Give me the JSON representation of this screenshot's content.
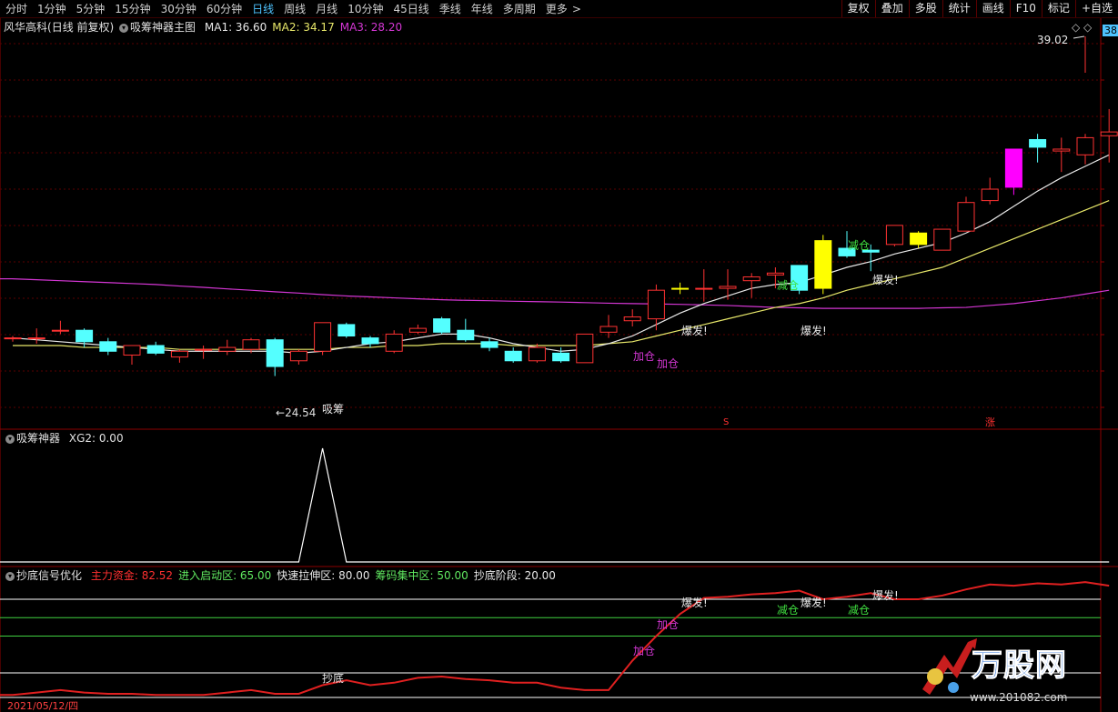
{
  "toolbar": {
    "periods": [
      "分时",
      "1分钟",
      "5分钟",
      "15分钟",
      "30分钟",
      "60分钟",
      "日线",
      "周线",
      "月线",
      "10分钟",
      "45日线",
      "季线",
      "年线",
      "多周期",
      "更多"
    ],
    "active_period": "日线",
    "more_arrow": ">",
    "tools": [
      "复权",
      "叠加",
      "多股",
      "统计",
      "画线",
      "F10",
      "标记",
      "+自选"
    ]
  },
  "main_panel": {
    "stock_name": "风华高科",
    "adjust_mode": "(日线 前复权)",
    "indicator_name": "吸筹神器主图",
    "ma": [
      {
        "label": "MA1: 36.60",
        "color": "#e8e8e8"
      },
      {
        "label": "MA2: 34.17",
        "color": "#e8e86a"
      },
      {
        "label": "MA3: 28.20",
        "color": "#d436d4"
      }
    ],
    "price_high_label": "39.02",
    "price_low_label": "24.54",
    "right_price_tag": "38",
    "marker_s": "S",
    "marker_zhang": "涨",
    "signals": {
      "buy_zone": "吸筹",
      "add": "加仓",
      "burst": "爆发!",
      "reduce": "减仓"
    }
  },
  "xg_panel": {
    "title": "吸筹神器",
    "value": "XG2: 0.00",
    "peak_value": 1,
    "peak_index": 13
  },
  "bottom_panel": {
    "title": "抄底信号优化",
    "fields": [
      {
        "label": "主力资金: 82.52",
        "color": "#ff3030"
      },
      {
        "label": "进入启动区: 65.00",
        "color": "#60e860"
      },
      {
        "label": "快速拉伸区: 80.00",
        "color": "#e8e8e8"
      },
      {
        "label": "筹码集中区: 50.00",
        "color": "#60e860"
      },
      {
        "label": "抄底阶段: 20.00",
        "color": "#e8e8e8"
      }
    ],
    "date_label": "2021/05/12/四",
    "signals": {
      "bottom": "抄底",
      "add": "加仓",
      "burst": "爆发!",
      "reduce": "减仓"
    }
  },
  "watermark": {
    "brand": "万股网",
    "url": "www.201082.com"
  },
  "colors": {
    "up": "#ff3232",
    "down": "#54ffff",
    "special_up_yellow": "#ffff00",
    "special_up_magenta": "#ff00ff",
    "ma1": "#e8e8e8",
    "ma2": "#e8e86a",
    "ma3": "#d436d4",
    "grid": "#8b0000"
  },
  "chart_data": {
    "type": "candlestick",
    "price_range": [
      23.5,
      41
    ],
    "candles": [
      {
        "o": 27.0,
        "h": 27.1,
        "l": 26.8,
        "c": 27.0
      },
      {
        "o": 27.0,
        "h": 27.5,
        "l": 26.7,
        "c": 27.0
      },
      {
        "o": 27.4,
        "h": 27.9,
        "l": 27.2,
        "c": 27.4
      },
      {
        "o": 27.4,
        "h": 27.5,
        "l": 26.5,
        "c": 26.8
      },
      {
        "o": 26.8,
        "h": 27.0,
        "l": 26.1,
        "c": 26.3
      },
      {
        "o": 26.1,
        "h": 26.6,
        "l": 25.6,
        "c": 26.6
      },
      {
        "o": 26.6,
        "h": 26.8,
        "l": 26.1,
        "c": 26.2
      },
      {
        "o": 26.0,
        "h": 26.4,
        "l": 25.7,
        "c": 26.3
      },
      {
        "o": 26.4,
        "h": 26.6,
        "l": 25.9,
        "c": 26.4
      },
      {
        "o": 26.3,
        "h": 26.9,
        "l": 26.1,
        "c": 26.5
      },
      {
        "o": 26.4,
        "h": 27.0,
        "l": 26.2,
        "c": 26.9
      },
      {
        "o": 26.9,
        "h": 27.0,
        "l": 25.0,
        "c": 25.5
      },
      {
        "o": 25.8,
        "h": 26.4,
        "l": 25.6,
        "c": 26.3
      },
      {
        "o": 26.3,
        "h": 27.8,
        "l": 26.1,
        "c": 27.8
      },
      {
        "o": 27.7,
        "h": 27.8,
        "l": 27.0,
        "c": 27.1
      },
      {
        "o": 27.0,
        "h": 27.1,
        "l": 26.5,
        "c": 26.7
      },
      {
        "o": 26.3,
        "h": 27.4,
        "l": 26.2,
        "c": 27.2
      },
      {
        "o": 27.3,
        "h": 27.7,
        "l": 27.2,
        "c": 27.5
      },
      {
        "o": 28.0,
        "h": 28.1,
        "l": 27.2,
        "c": 27.3
      },
      {
        "o": 27.4,
        "h": 28.0,
        "l": 26.8,
        "c": 26.9
      },
      {
        "o": 26.8,
        "h": 27.0,
        "l": 26.3,
        "c": 26.5
      },
      {
        "o": 26.3,
        "h": 26.5,
        "l": 25.7,
        "c": 25.8
      },
      {
        "o": 25.8,
        "h": 26.7,
        "l": 25.7,
        "c": 26.5
      },
      {
        "o": 26.2,
        "h": 26.5,
        "l": 25.7,
        "c": 25.8
      },
      {
        "o": 25.7,
        "h": 27.2,
        "l": 25.7,
        "c": 27.2
      },
      {
        "o": 27.3,
        "h": 28.2,
        "l": 27.0,
        "c": 27.6
      },
      {
        "o": 27.9,
        "h": 28.5,
        "l": 27.6,
        "c": 28.1
      },
      {
        "o": 28.0,
        "h": 29.8,
        "l": 27.4,
        "c": 29.5
      },
      {
        "o": 29.6,
        "h": 29.9,
        "l": 29.3,
        "c": 29.6
      },
      {
        "o": 29.6,
        "h": 30.6,
        "l": 28.9,
        "c": 29.6
      },
      {
        "o": 29.6,
        "h": 30.6,
        "l": 29.0,
        "c": 29.7
      },
      {
        "o": 30.0,
        "h": 30.4,
        "l": 29.1,
        "c": 30.2
      },
      {
        "o": 30.3,
        "h": 30.7,
        "l": 29.6,
        "c": 30.4
      },
      {
        "o": 30.8,
        "h": 30.8,
        "l": 29.3,
        "c": 29.5
      },
      {
        "o": 29.6,
        "h": 32.4,
        "l": 29.3,
        "c": 32.1
      },
      {
        "o": 31.7,
        "h": 32.6,
        "l": 31.2,
        "c": 31.3
      },
      {
        "o": 31.6,
        "h": 31.9,
        "l": 30.5,
        "c": 31.5
      },
      {
        "o": 31.9,
        "h": 32.9,
        "l": 31.8,
        "c": 32.9
      },
      {
        "o": 32.5,
        "h": 32.6,
        "l": 31.7,
        "c": 31.9
      },
      {
        "o": 31.6,
        "h": 32.7,
        "l": 31.6,
        "c": 32.7
      },
      {
        "o": 32.6,
        "h": 34.4,
        "l": 32.6,
        "c": 34.1
      },
      {
        "o": 34.2,
        "h": 35.4,
        "l": 34.0,
        "c": 34.8
      },
      {
        "o": 34.9,
        "h": 36.3,
        "l": 34.5,
        "c": 36.9
      },
      {
        "o": 37.4,
        "h": 37.7,
        "l": 36.2,
        "c": 37.0
      },
      {
        "o": 36.8,
        "h": 37.5,
        "l": 35.7,
        "c": 36.9
      },
      {
        "o": 36.6,
        "h": 37.7,
        "l": 36.1,
        "c": 37.5
      },
      {
        "o": 37.6,
        "h": 39.0,
        "l": 36.2,
        "c": 37.8
      }
    ],
    "ma1": [
      27.0,
      26.9,
      26.8,
      26.7,
      26.6,
      26.5,
      26.4,
      26.3,
      26.3,
      26.3,
      26.3,
      26.3,
      26.2,
      26.3,
      26.5,
      26.7,
      26.8,
      27.0,
      27.2,
      27.2,
      27.0,
      26.7,
      26.5,
      26.3,
      26.4,
      26.7,
      27.1,
      27.7,
      28.3,
      28.8,
      29.2,
      29.6,
      29.8,
      29.9,
      30.3,
      30.7,
      31.0,
      31.4,
      31.7,
      32.0,
      32.5,
      33.1,
      33.9,
      34.7,
      35.4,
      36.0,
      36.6
    ],
    "ma2": [
      26.6,
      26.6,
      26.6,
      26.5,
      26.5,
      26.5,
      26.5,
      26.4,
      26.4,
      26.4,
      26.4,
      26.4,
      26.4,
      26.4,
      26.5,
      26.5,
      26.6,
      26.6,
      26.7,
      26.7,
      26.7,
      26.6,
      26.6,
      26.6,
      26.6,
      26.7,
      26.8,
      27.1,
      27.4,
      27.7,
      28.0,
      28.3,
      28.6,
      28.8,
      29.1,
      29.5,
      29.8,
      30.1,
      30.4,
      30.7,
      31.2,
      31.7,
      32.2,
      32.7,
      33.2,
      33.7,
      34.2
    ],
    "ma3": [
      30.1,
      30.05,
      30.0,
      29.95,
      29.9,
      29.85,
      29.8,
      29.72,
      29.65,
      29.57,
      29.5,
      29.42,
      29.35,
      29.27,
      29.2,
      29.15,
      29.1,
      29.05,
      29.0,
      28.97,
      28.95,
      28.92,
      28.9,
      28.88,
      28.85,
      28.82,
      28.8,
      28.78,
      28.76,
      28.73,
      28.7,
      28.65,
      28.6,
      28.58,
      28.55,
      28.55,
      28.55,
      28.55,
      28.55,
      28.58,
      28.6,
      28.7,
      28.8,
      28.95,
      29.1,
      29.3,
      29.5
    ],
    "xg2": [
      0,
      0,
      0,
      0,
      0,
      0,
      0,
      0,
      0,
      0,
      0,
      0,
      0,
      1,
      0,
      0,
      0,
      0,
      0,
      0,
      0,
      0,
      0,
      0,
      0,
      0,
      0,
      0,
      0,
      0,
      0,
      0,
      0,
      0,
      0,
      0,
      0,
      0,
      0,
      0,
      0,
      0,
      0,
      0,
      0,
      0,
      0
    ],
    "main_force": [
      2,
      4,
      6,
      4,
      3,
      3,
      2,
      2,
      2,
      4,
      6,
      3,
      3,
      10,
      14,
      10,
      12,
      16,
      17,
      15,
      14,
      12,
      12,
      8,
      6,
      6,
      30,
      50,
      68,
      81,
      82,
      84,
      85,
      87,
      80,
      82,
      85,
      80,
      80,
      83,
      88,
      92,
      91,
      93,
      92,
      94,
      91
    ],
    "thresholds": {
      "entry_start": 65,
      "fast_stretch": 80,
      "chip_concentration": 50,
      "bottom_stage": 20
    }
  }
}
